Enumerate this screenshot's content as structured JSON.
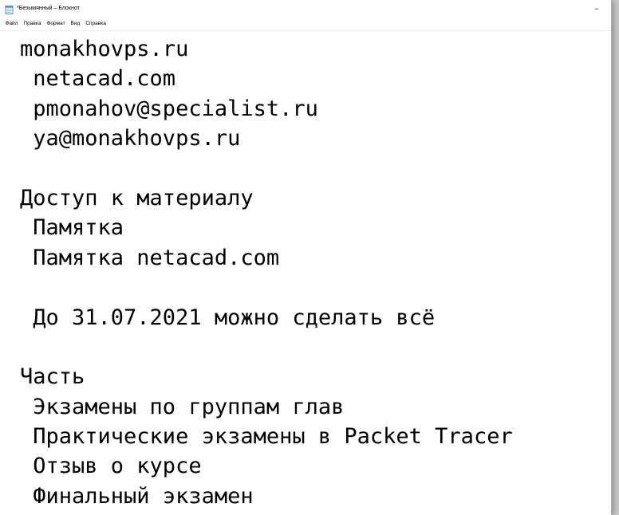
{
  "window": {
    "title": "*Безымянный – Блокнот",
    "minimize_glyph": "–"
  },
  "menu": [
    "Файл",
    "Правка",
    "Формат",
    "Вид",
    "Справка"
  ],
  "editor": {
    "lines": [
      "monakhovps.ru",
      " netacad.com",
      " pmonahov@specialist.ru",
      " ya@monakhovps.ru",
      "",
      "Доступ к материалу",
      " Памятка",
      " Памятка netacad.com",
      "",
      " До 31.07.2021 можно сделать всё",
      "",
      "Часть",
      " Экзамены по группам глав",
      " Практические экзамены в Packet Tracer",
      " Отзыв о курсе",
      " Финальный экзамен"
    ]
  },
  "icons": {
    "app": "notepad-icon"
  },
  "colors": {
    "background": "#ffffff",
    "text": "#000000",
    "desktop": "#c9c9c9"
  }
}
